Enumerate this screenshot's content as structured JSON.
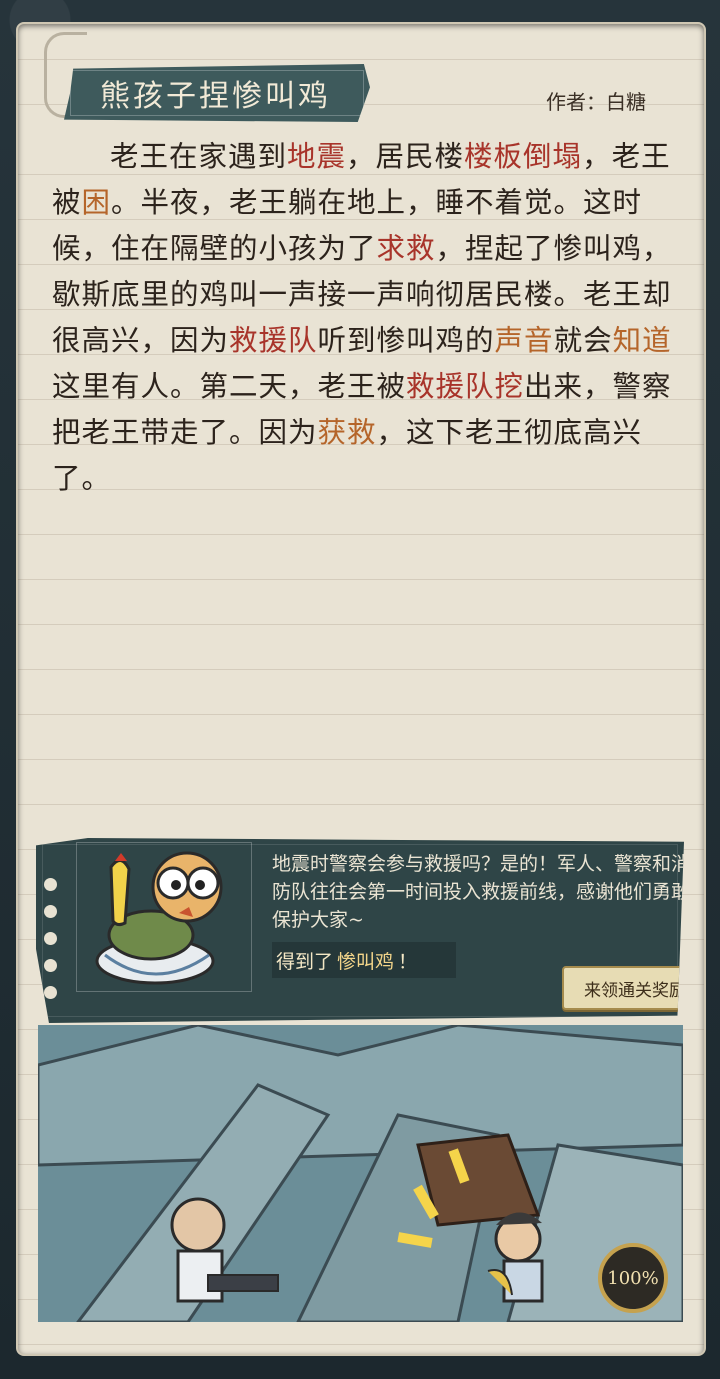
{
  "story": {
    "title": "熊孩子捏惨叫鸡",
    "author": "作者：白糖",
    "segments": [
      {
        "t": "老王在家遇到",
        "c": ""
      },
      {
        "t": "地震",
        "c": "red"
      },
      {
        "t": "，居民楼",
        "c": ""
      },
      {
        "t": "楼板倒塌",
        "c": "red"
      },
      {
        "t": "，老王被",
        "c": ""
      },
      {
        "t": "困",
        "c": "orange"
      },
      {
        "t": "。半夜，老王躺在地上，睡不着觉。这时候，住在隔壁的小孩为了",
        "c": ""
      },
      {
        "t": "求救",
        "c": "red"
      },
      {
        "t": "，捏起了惨叫鸡，歇斯底里的鸡叫一声接一声响彻居民楼。老王却很高兴，因为",
        "c": ""
      },
      {
        "t": "救援队",
        "c": "red"
      },
      {
        "t": "听到惨叫鸡的",
        "c": ""
      },
      {
        "t": "声音",
        "c": "orange"
      },
      {
        "t": "就会",
        "c": ""
      },
      {
        "t": "知道",
        "c": "orange"
      },
      {
        "t": "这里有人。第二天，老王被",
        "c": ""
      },
      {
        "t": "救援队挖",
        "c": "red"
      },
      {
        "t": "出来，警察把老王带走了。因为",
        "c": ""
      },
      {
        "t": "获救",
        "c": "orange"
      },
      {
        "t": "，这下老王彻底高兴了。",
        "c": ""
      }
    ]
  },
  "reward_panel": {
    "info": "地震时警察会参与救援吗？是的！军人、警察和消防队往往会第一时间投入救援前线，感谢他们勇敢保护大家~",
    "got_prefix": "得到了",
    "got_item": "惨叫鸡",
    "got_suffix": "！",
    "claim_label": "来领通关奖励"
  },
  "progress_label": "100%",
  "colors": {
    "highlight_red": "#a8342a",
    "highlight_orange": "#b5652a",
    "banner": "#3e5a5c"
  }
}
